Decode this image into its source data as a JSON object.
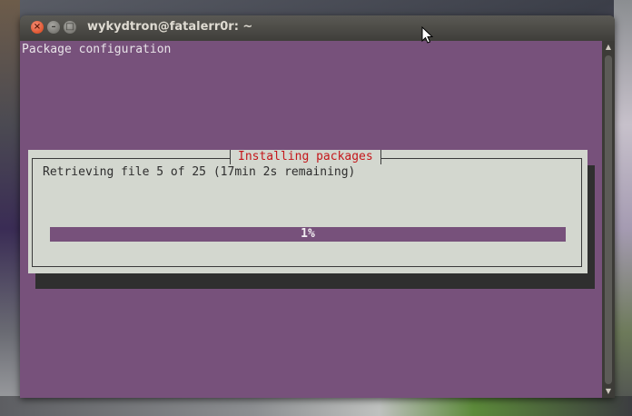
{
  "window": {
    "title": "wykydtron@fatalerr0r: ~"
  },
  "terminal": {
    "header_line": "Package configuration"
  },
  "dialog": {
    "title": "Installing packages",
    "message": "Retrieving file 5 of 25 (17min 2s remaining)",
    "progress_percent": 1,
    "progress_label": "1%"
  },
  "colors": {
    "terminal_bg": "#77517b",
    "dialog_bg": "#d3d7cf",
    "dialog_title": "#c4171b"
  },
  "icons": {
    "close": "close-icon",
    "minimize": "minimize-icon",
    "maximize": "maximize-icon",
    "cursor": "mouse-pointer-icon"
  }
}
